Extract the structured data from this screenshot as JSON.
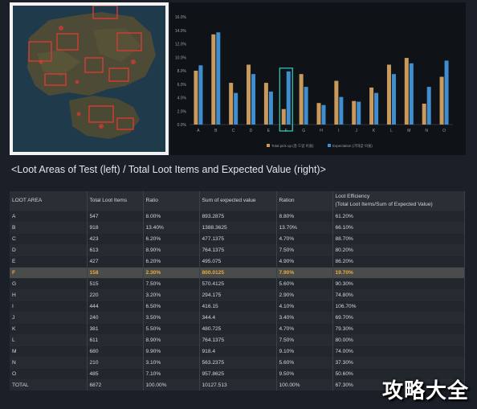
{
  "caption": "<Loot Areas of Test (left) / Total Loot Items and Expected Value (right)>",
  "legend": {
    "series1": "Total pick up (총 드랍 비율)",
    "series2": "Expectation (기대값 비율)"
  },
  "chart_data": {
    "type": "bar",
    "categories": [
      "A",
      "B",
      "C",
      "D",
      "E",
      "F",
      "G",
      "H",
      "I",
      "J",
      "K",
      "L",
      "M",
      "N",
      "O"
    ],
    "ylim": [
      0,
      16
    ],
    "yticks": [
      "0.0%",
      "2.0%",
      "4.0%",
      "6.0%",
      "8.0%",
      "10.0%",
      "12.0%",
      "14.0%",
      "16.0%"
    ],
    "series": [
      {
        "name": "Total pick up (총 드랍 비율)",
        "color": "#c99a5b",
        "values": [
          8.0,
          13.4,
          6.2,
          8.9,
          6.2,
          2.3,
          7.5,
          3.2,
          6.5,
          3.5,
          5.5,
          8.9,
          9.9,
          3.1,
          7.1
        ]
      },
      {
        "name": "Expectation (기대값 비율)",
        "color": "#3f8fd0",
        "values": [
          8.8,
          13.7,
          4.7,
          7.5,
          4.9,
          7.9,
          5.6,
          2.9,
          4.1,
          3.4,
          4.7,
          7.5,
          9.1,
          5.6,
          9.5
        ]
      }
    ],
    "highlight": "F"
  },
  "table": {
    "headers": [
      "LOOT AREA",
      "Total Loot Items",
      "Ratio",
      "Sum of expected value",
      "Ration",
      "Loot Efficiency\n(Total Loot Items/Sum of Expected Value)"
    ],
    "rows": [
      [
        "A",
        "547",
        "8.00%",
        "893.2875",
        "8.80%",
        "61.20%"
      ],
      [
        "B",
        "918",
        "13.40%",
        "1388.3625",
        "13.70%",
        "66.10%"
      ],
      [
        "C",
        "423",
        "6.20%",
        "477.1375",
        "4.70%",
        "88.70%"
      ],
      [
        "D",
        "613",
        "8.90%",
        "764.1375",
        "7.50%",
        "80.20%"
      ],
      [
        "E",
        "427",
        "6.20%",
        "495.075",
        "4.90%",
        "86.20%"
      ],
      [
        "F",
        "158",
        "2.30%",
        "800.0125",
        "7.90%",
        "19.70%"
      ],
      [
        "G",
        "515",
        "7.50%",
        "570.4125",
        "5.60%",
        "90.30%"
      ],
      [
        "H",
        "220",
        "3.20%",
        "294.175",
        "2.90%",
        "74.80%"
      ],
      [
        "I",
        "444",
        "6.50%",
        "416.15",
        "4.10%",
        "106.70%"
      ],
      [
        "J",
        "240",
        "3.50%",
        "344.4",
        "3.40%",
        "69.70%"
      ],
      [
        "K",
        "381",
        "5.50%",
        "480.725",
        "4.70%",
        "79.30%"
      ],
      [
        "L",
        "611",
        "8.90%",
        "764.1375",
        "7.50%",
        "80.00%"
      ],
      [
        "M",
        "680",
        "9.90%",
        "918.4",
        "9.10%",
        "74.00%"
      ],
      [
        "N",
        "210",
        "3.10%",
        "563.2375",
        "5.60%",
        "37.30%"
      ],
      [
        "O",
        "485",
        "7.10%",
        "957.8625",
        "9.50%",
        "50.60%"
      ],
      [
        "TOTAL",
        "6872",
        "100.00%",
        "10127.513",
        "100.00%",
        "67.30%"
      ]
    ]
  },
  "watermark": "攻略大全"
}
